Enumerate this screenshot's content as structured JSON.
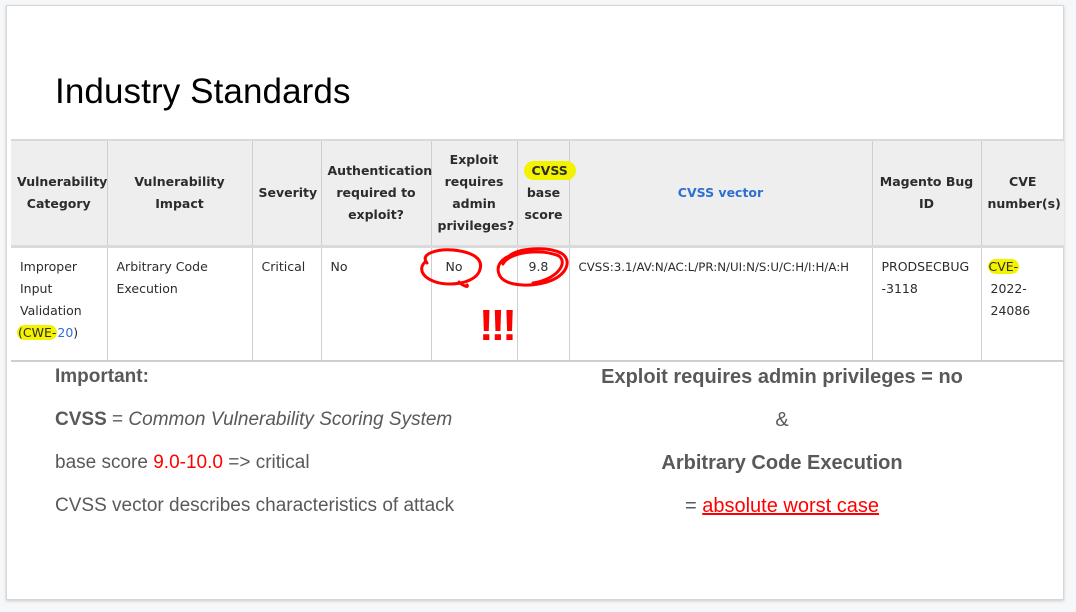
{
  "slide": {
    "title": "Industry Standards"
  },
  "table": {
    "headers": [
      {
        "label": "Vulnerability Category"
      },
      {
        "label": "Vulnerability Impact"
      },
      {
        "label": "Severity"
      },
      {
        "label": "Authentication required to exploit?"
      },
      {
        "label": "Exploit requires admin privileges?"
      },
      {
        "label_highlight": "CVSS",
        "label_rest": "base score"
      },
      {
        "label": "CVSS vector"
      },
      {
        "label": "Magento Bug ID"
      },
      {
        "label": "CVE number(s)"
      }
    ],
    "rows": [
      {
        "category": "Improper Input Validation",
        "category_cwe_prefix": "(CWE-",
        "category_cwe_id": "20",
        "category_cwe_suffix": ")",
        "impact": "Arbitrary Code Execution",
        "severity": "Critical",
        "auth_required": "No",
        "admin_required": "No",
        "base_score": "9.8",
        "cvss_vector": "CVSS:3.1/AV:N/AC:L/PR:N/UI:N/S:U/C:H/I:H/A:H",
        "bug_id": "PRODSECBUG-3118",
        "cve_prefix": "CVE-",
        "cve_rest": "2022-24086"
      }
    ]
  },
  "annotations": {
    "exclamation": "!!!",
    "highlight_color": "#f3f300",
    "circle_color": "#ff0000"
  },
  "notes_left": {
    "heading": "Important:",
    "cvss_abbr": "CVSS",
    "cvss_eq": " = ",
    "cvss_full": "Common Vulnerability Scoring System",
    "score_prefix": "base score ",
    "score_range": "9.0-10.0",
    "score_suffix": " => critical",
    "vector_desc": "CVSS vector describes characteristics of attack"
  },
  "notes_right": {
    "line1": "Exploit requires admin privileges = no",
    "line2": "&",
    "line3": "Arbitrary Code Execution",
    "line4_prefix": "= ",
    "line4_emph": "absolute worst case"
  }
}
